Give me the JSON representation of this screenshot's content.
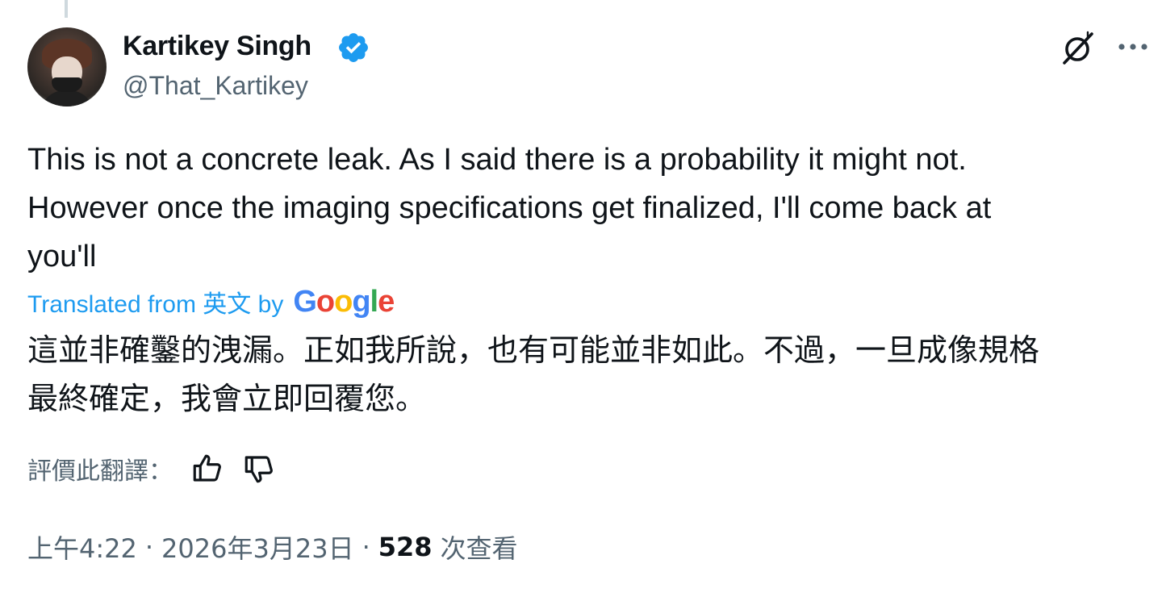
{
  "author": {
    "name": "Kartikey Singh",
    "handle": "@That_Kartikey",
    "verified": true
  },
  "tweet": {
    "text": "This is not a concrete leak. As I said there is a probability it might not.\nHowever once the imaging specifications get finalized, I'll come back at\nyou'll"
  },
  "translation": {
    "label": "Translated from 英文 by",
    "provider": "Google",
    "text": "這並非確鑿的洩漏。正如我所說，也有可能並非如此。不過，一旦成像規格\n最終確定，我會立即回覆您。",
    "rate_label": "評價此翻譯："
  },
  "meta": {
    "time": "上午4:22",
    "date": "2026年3月23日",
    "separator": "·",
    "views_count": "528",
    "views_label": "次查看"
  },
  "icons": {
    "verified": "verified-badge-icon",
    "grok": "grok-icon",
    "more": "more-options-icon",
    "thumbs_up": "thumbs-up-icon",
    "thumbs_down": "thumbs-down-icon"
  },
  "colors": {
    "accent": "#1d9bf0",
    "text": "#0f1419",
    "secondary": "#536471",
    "google_blue": "#4285f4",
    "google_red": "#ea4335",
    "google_yellow": "#fbbc05",
    "google_green": "#34a853"
  }
}
